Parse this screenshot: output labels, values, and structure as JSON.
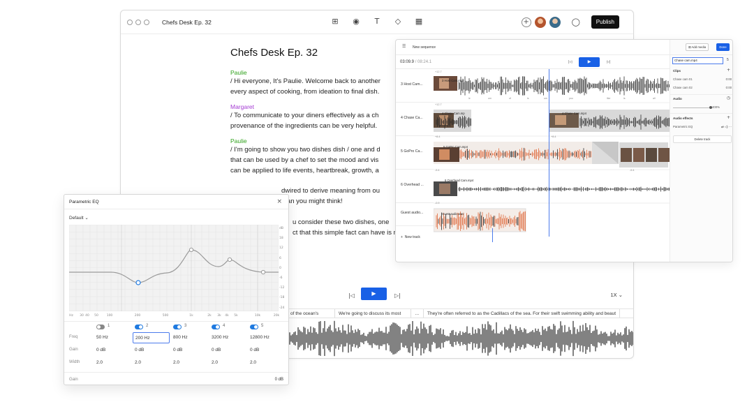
{
  "main": {
    "doc_title": "Chefs Desk Ep. 32",
    "publish": "Publish",
    "transcript_title": "Chefs Desk Ep. 32",
    "blocks": [
      {
        "speaker": "Paulie",
        "lines": [
          "/ Hi everyone, It's Paulie. Welcome back to another",
          "every aspect of cooking, from ideation to final dish."
        ]
      },
      {
        "speaker": "Margaret",
        "lines": [
          "/ To communicate to your diners effectively as a ch",
          "provenance of the ingredients can be very helpful."
        ]
      },
      {
        "speaker": "Paulie",
        "lines": [
          "/ I'm going to show you two dishes dish / one and d",
          "that can be used by a chef to set the mood and vis",
          "can be applied to life events, heartbreak, growth, a"
        ]
      }
    ],
    "hidden_lines": [
      "dwired to derive meaning from ou",
      "than you might think!",
      "u consider these two dishes, one",
      "ct that this simple fact can have is not at all obvious."
    ],
    "speed": "1X",
    "captions": [
      "of the ocean's",
      "We're going to discuss its most",
      "...",
      "They're often referred to as the Cadillacs of the sea. For their swift swimming ability and beaut"
    ]
  },
  "sequence": {
    "label": "New sequence",
    "time_current": "03:09.9",
    "time_sep": " / ",
    "time_total": "08:24.1",
    "tracks": [
      "3 Host Cam...",
      "4 Chase Ca...",
      "5 GoPro Ca...",
      "6 Overhead ...",
      "Guest audio..."
    ],
    "clips": [
      "3 Host Cam.mp4",
      "4 Chase Cam.mp",
      "4 Chase Cam.mp4",
      "5 GoPro Cam.mp4",
      "6 Overhead Cam.mp4",
      "Guest audio.wav"
    ],
    "gains": [
      "+12.7",
      "+12.7",
      "+8.4",
      "+8.4",
      "-5.4",
      "-5.4",
      "-0.9"
    ],
    "words_host": [
      "le",
      "um",
      "of",
      "is",
      "um",
      "you",
      "like",
      "is",
      "all"
    ],
    "new_track": "New track",
    "inspector": {
      "add_media": "Add media",
      "done": "Done",
      "clip_name": "Chase cam.mp4",
      "clip_count": "5",
      "clips_heading": "Clips",
      "clips": [
        {
          "name": "Chase cam 01",
          "time": "0:00"
        },
        {
          "name": "Chase cam 02",
          "time": "0:00"
        }
      ],
      "audio_heading": "Audio",
      "volume": "400%",
      "effects_heading": "Audio effects",
      "effect": "Parametric EQ",
      "delete": "Delete track"
    }
  },
  "eq": {
    "title": "Parametric EQ",
    "preset": "Default",
    "db_scale": [
      "dB",
      "18",
      "12",
      "6",
      "0",
      "-6",
      "-12",
      "-18",
      "-24"
    ],
    "hz_scale": [
      "Hz",
      "30",
      "40",
      "50",
      "100",
      "200",
      "500",
      "1k",
      "2k",
      "3k",
      "4k",
      "5k",
      "10k",
      "20k"
    ],
    "rows": [
      "Freq",
      "Gain",
      "Width"
    ],
    "bands": [
      {
        "num": "1",
        "on": false,
        "freq": "50 Hz",
        "gain": "0 dB",
        "width": "2.0"
      },
      {
        "num": "2",
        "on": true,
        "freq": "200 Hz",
        "gain": "0 dB",
        "width": "2.0"
      },
      {
        "num": "3",
        "on": true,
        "freq": "800 Hz",
        "gain": "0 dB",
        "width": "2.0"
      },
      {
        "num": "4",
        "on": true,
        "freq": "3200 Hz",
        "gain": "0 dB",
        "width": "2.0"
      },
      {
        "num": "5",
        "on": true,
        "freq": "12800 Hz",
        "gain": "0 dB",
        "width": "2.0"
      }
    ],
    "gain_label": "Gain",
    "gain_value": "0 dB"
  },
  "colors": {
    "accent": "#1860e6",
    "green": "#2fa11b",
    "purple": "#a43bd3",
    "waveform": "#2b2b2b",
    "audio_orange": "#e06a3b"
  },
  "icons": [
    "insert-icon",
    "record-icon",
    "text-icon",
    "shapes-icon",
    "grid-icon",
    "comment-icon",
    "play-icon",
    "skip-back-icon",
    "skip-forward-icon",
    "close-icon"
  ]
}
